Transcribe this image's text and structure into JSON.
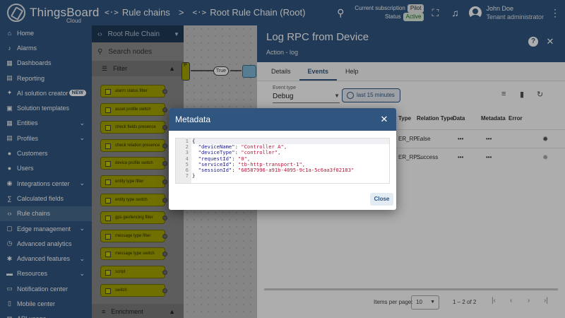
{
  "app": {
    "name": "ThingsBoard",
    "edition": "Cloud"
  },
  "breadcrumb": {
    "items": [
      "Rule chains",
      "Root Rule Chain (Root)"
    ],
    "separator": ">",
    "icon_glyph": "<·>"
  },
  "header": {
    "subscription_label": "Current subscription",
    "subscription_value": "Pilot",
    "status_label": "Status",
    "status_value": "Active",
    "user_name": "John Doe",
    "user_role": "Tenant administrator"
  },
  "sidebar": {
    "items": [
      {
        "label": "Home",
        "icon": "home-icon",
        "glyph": "⌂"
      },
      {
        "label": "Alarms",
        "icon": "bell-icon",
        "glyph": "♪"
      },
      {
        "label": "Dashboards",
        "icon": "dashboard-icon",
        "glyph": "▦"
      },
      {
        "label": "Reporting",
        "icon": "report-icon",
        "glyph": "▤"
      },
      {
        "label": "AI solution creator",
        "icon": "sparkle-icon",
        "glyph": "✦",
        "badge": "NEW"
      },
      {
        "label": "Solution templates",
        "icon": "template-icon",
        "glyph": "▣"
      },
      {
        "label": "Entities",
        "icon": "entities-icon",
        "glyph": "▦",
        "expandable": true
      },
      {
        "label": "Profiles",
        "icon": "profiles-icon",
        "glyph": "▤",
        "expandable": true
      },
      {
        "label": "Customers",
        "icon": "customers-icon",
        "glyph": "●"
      },
      {
        "label": "Users",
        "icon": "users-icon",
        "glyph": "●"
      },
      {
        "label": "Integrations center",
        "icon": "integrations-icon",
        "glyph": "◉",
        "expandable": true
      },
      {
        "label": "Calculated fields",
        "icon": "calculator-icon",
        "glyph": "∑"
      },
      {
        "label": "Rule chains",
        "icon": "rule-chain-icon",
        "glyph": "‹›",
        "active": true
      },
      {
        "label": "Edge management",
        "icon": "edge-icon",
        "glyph": "▢",
        "expandable": true
      },
      {
        "label": "Advanced analytics",
        "icon": "analytics-icon",
        "glyph": "◷"
      },
      {
        "label": "Advanced features",
        "icon": "features-icon",
        "glyph": "✱",
        "expandable": true
      },
      {
        "label": "Resources",
        "icon": "folder-icon",
        "glyph": "▬",
        "expandable": true
      },
      {
        "label": "Notification center",
        "icon": "notification-icon",
        "glyph": "▭"
      },
      {
        "label": "Mobile center",
        "icon": "mobile-icon",
        "glyph": "▯"
      },
      {
        "label": "API usage",
        "icon": "api-icon",
        "glyph": "▥"
      }
    ]
  },
  "library": {
    "title": "Root Rule Chain",
    "search_placeholder": "Search nodes",
    "section_filter": "Filter",
    "section_enrichment": "Enrichment",
    "nodes": [
      "alarm status filter",
      "asset profile switch",
      "check fields presence",
      "check relation presence",
      "device profile switch",
      "entity type filter",
      "entity type switch",
      "gps geofencing filter",
      "message type filter",
      "message type switch",
      "script",
      "switch"
    ]
  },
  "canvas": {
    "link_label": "True",
    "node_label": "P"
  },
  "panel": {
    "title": "Log RPC from Device",
    "subtitle": "Action - log",
    "tabs": [
      "Details",
      "Events",
      "Help"
    ],
    "active_tab": "Events",
    "event_type_label": "Event type",
    "event_type_value": "Debug",
    "time_button": "last 15 minutes",
    "columns": [
      "Type",
      "Relation Type",
      "Data",
      "Metadata",
      "Error"
    ],
    "rows": [
      {
        "type": "ER_RP...",
        "relation": "False",
        "data": "•••",
        "metadata": "•••"
      },
      {
        "type": "ER_RP...",
        "relation": "Success",
        "data": "•••",
        "metadata": "•••"
      }
    ],
    "items_per_page_label": "Items per page:",
    "items_per_page": "10",
    "range": "1 – 2 of 2"
  },
  "dialog": {
    "title": "Metadata",
    "close_button": "Close",
    "line_numbers": [
      "1",
      "2",
      "3",
      "4",
      "5",
      "6",
      "7"
    ],
    "lines": [
      {
        "text": "{"
      },
      {
        "key": "\"deviceName\"",
        "value": "\"Controller A\","
      },
      {
        "key": "\"deviceType\"",
        "value": "\"controller\","
      },
      {
        "key": "\"requestId\"",
        "value": "\"0\","
      },
      {
        "key": "\"serviceId\"",
        "value": "\"tb-http-transport-1\","
      },
      {
        "key": "\"sessionId\"",
        "value": "\"68587996-a91b-4095-9c1a-5c6aa3f02183\""
      },
      {
        "text": "}"
      }
    ]
  },
  "colors": {
    "primary": "#305680",
    "node_yellow": "#a6a600",
    "string_red": "#b3173a"
  }
}
